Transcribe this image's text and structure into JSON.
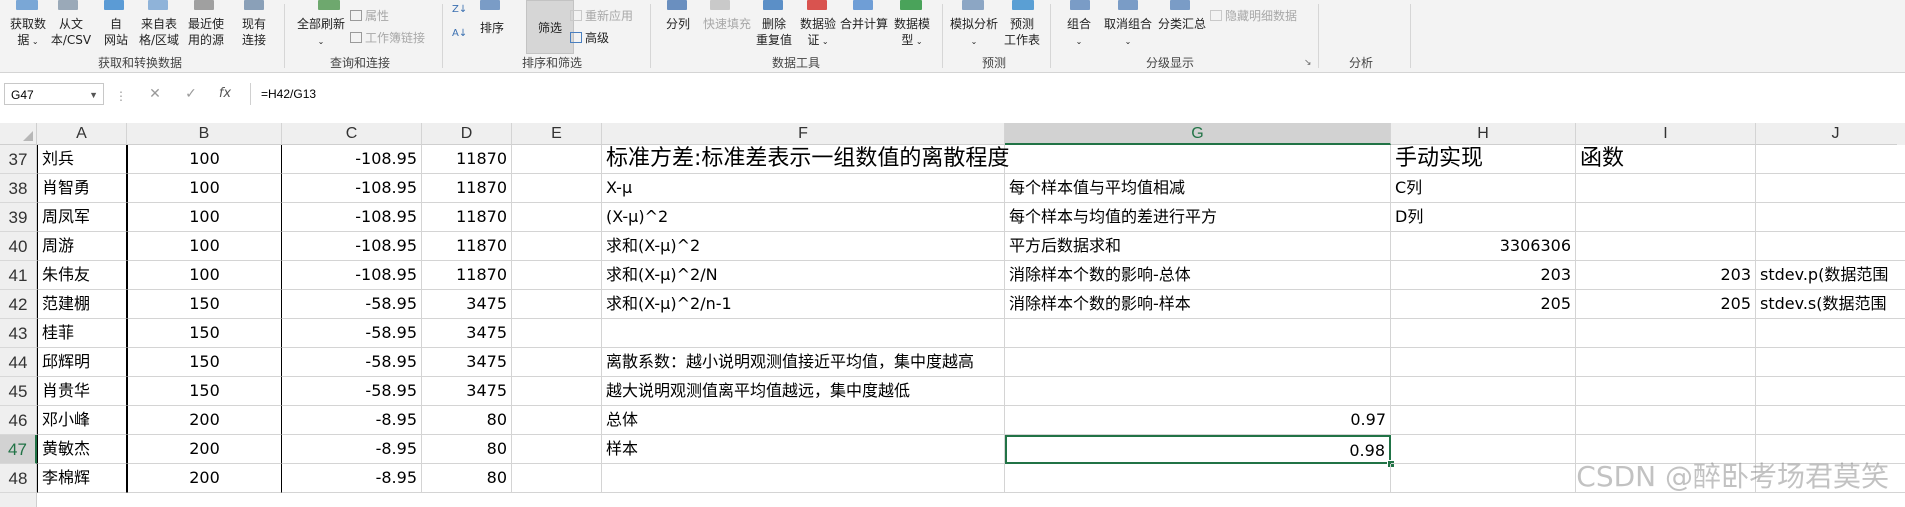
{
  "ribbon": {
    "data_group": {
      "get_data": "获取数\n据",
      "from_text": "从文\n本/CSV",
      "from_web": "自\n网站",
      "from_table": "来自表\n格/区域",
      "recent": "最近使\n用的源",
      "existing": "现有\n连接",
      "label": "获取和转换数据"
    },
    "query_group": {
      "refresh_all": "全部刷新",
      "properties": "属性",
      "edit_links": "工作簿链接",
      "label": "查询和连接"
    },
    "sort_group": {
      "sort": "排序",
      "filter": "筛选",
      "reapply": "重新应用",
      "advanced": "高级",
      "label": "排序和筛选"
    },
    "tools_group": {
      "split": "分列",
      "flash_fill": "快速填充",
      "remove_dup": "删除\n重复值",
      "validation": "数据验\n证",
      "consolidate": "合并计算",
      "data_model": "数据模\n型",
      "label": "数据工具"
    },
    "forecast_group": {
      "whatif": "模拟分析",
      "forecast": "预测\n工作表",
      "label": "预测"
    },
    "outline_group": {
      "group": "组合",
      "ungroup": "取消组合",
      "subtotal": "分类汇总",
      "hide_detail": "隐藏明细数据",
      "label": "分级显示"
    },
    "analysis_group": {
      "label": "分析"
    }
  },
  "formula_bar": {
    "name_box": "G47",
    "fx": "fx",
    "formula": "=H42/G13"
  },
  "columns": [
    "A",
    "B",
    "C",
    "D",
    "E",
    "F",
    "G",
    "H",
    "I",
    "J"
  ],
  "rows": [
    {
      "num": "37",
      "A": "刘兵",
      "B": "100",
      "C": "-108.95",
      "D": "11870",
      "F": "标准方差:标准差表示一组数值的离散程度",
      "G": "",
      "H": "手动实现",
      "I": "函数",
      "J": ""
    },
    {
      "num": "38",
      "A": "肖智勇",
      "B": "100",
      "C": "-108.95",
      "D": "11870",
      "F": "X-μ",
      "G": "每个样本值与平均值相减",
      "H": "C列",
      "I": "",
      "J": ""
    },
    {
      "num": "39",
      "A": "周凤军",
      "B": "100",
      "C": "-108.95",
      "D": "11870",
      "F": "(X-μ)^2",
      "G": "每个样本与均值的差进行平方",
      "H": "D列",
      "I": "",
      "J": ""
    },
    {
      "num": "40",
      "A": "周游",
      "B": "100",
      "C": "-108.95",
      "D": "11870",
      "F": "求和(X-μ)^2",
      "G": "平方后数据求和",
      "H": "3306306",
      "I": "",
      "J": ""
    },
    {
      "num": "41",
      "A": "朱伟友",
      "B": "100",
      "C": "-108.95",
      "D": "11870",
      "F": "求和(X-μ)^2/N",
      "G": "消除样本个数的影响-总体",
      "H": "203",
      "I": "203",
      "J": "stdev.p(数据范围"
    },
    {
      "num": "42",
      "A": "范建棚",
      "B": "150",
      "C": "-58.95",
      "D": "3475",
      "F": "求和(X-μ)^2/n-1",
      "G": "消除样本个数的影响-样本",
      "H": "205",
      "I": "205",
      "J": "stdev.s(数据范围"
    },
    {
      "num": "43",
      "A": "桂菲",
      "B": "150",
      "C": "-58.95",
      "D": "3475",
      "F": "",
      "G": "",
      "H": "",
      "I": "",
      "J": ""
    },
    {
      "num": "44",
      "A": "邱辉明",
      "B": "150",
      "C": "-58.95",
      "D": "3475",
      "F": "离散系数：越小说明观测值接近平均值，集中度越高",
      "G": "",
      "H": "",
      "I": "",
      "J": ""
    },
    {
      "num": "45",
      "A": "肖贵华",
      "B": "150",
      "C": "-58.95",
      "D": "3475",
      "F": "越大说明观测值离平均值越远，集中度越低",
      "G": "",
      "H": "",
      "I": "",
      "J": ""
    },
    {
      "num": "46",
      "A": "邓小峰",
      "B": "200",
      "C": "-8.95",
      "D": "80",
      "F": "总体",
      "G": "0.97",
      "H": "",
      "I": "",
      "J": ""
    },
    {
      "num": "47",
      "A": "黄敏杰",
      "B": "200",
      "C": "-8.95",
      "D": "80",
      "F": "样本",
      "G": "0.98",
      "H": "",
      "I": "",
      "J": ""
    },
    {
      "num": "48",
      "A": "李棉辉",
      "B": "200",
      "C": "-8.95",
      "D": "80",
      "F": "",
      "G": "",
      "H": "",
      "I": "",
      "J": ""
    }
  ],
  "selection": {
    "cell": "G47",
    "col": "G",
    "row": "47"
  },
  "accent_color": "#217346",
  "watermark": "CSDN @醉卧考场君莫笑"
}
